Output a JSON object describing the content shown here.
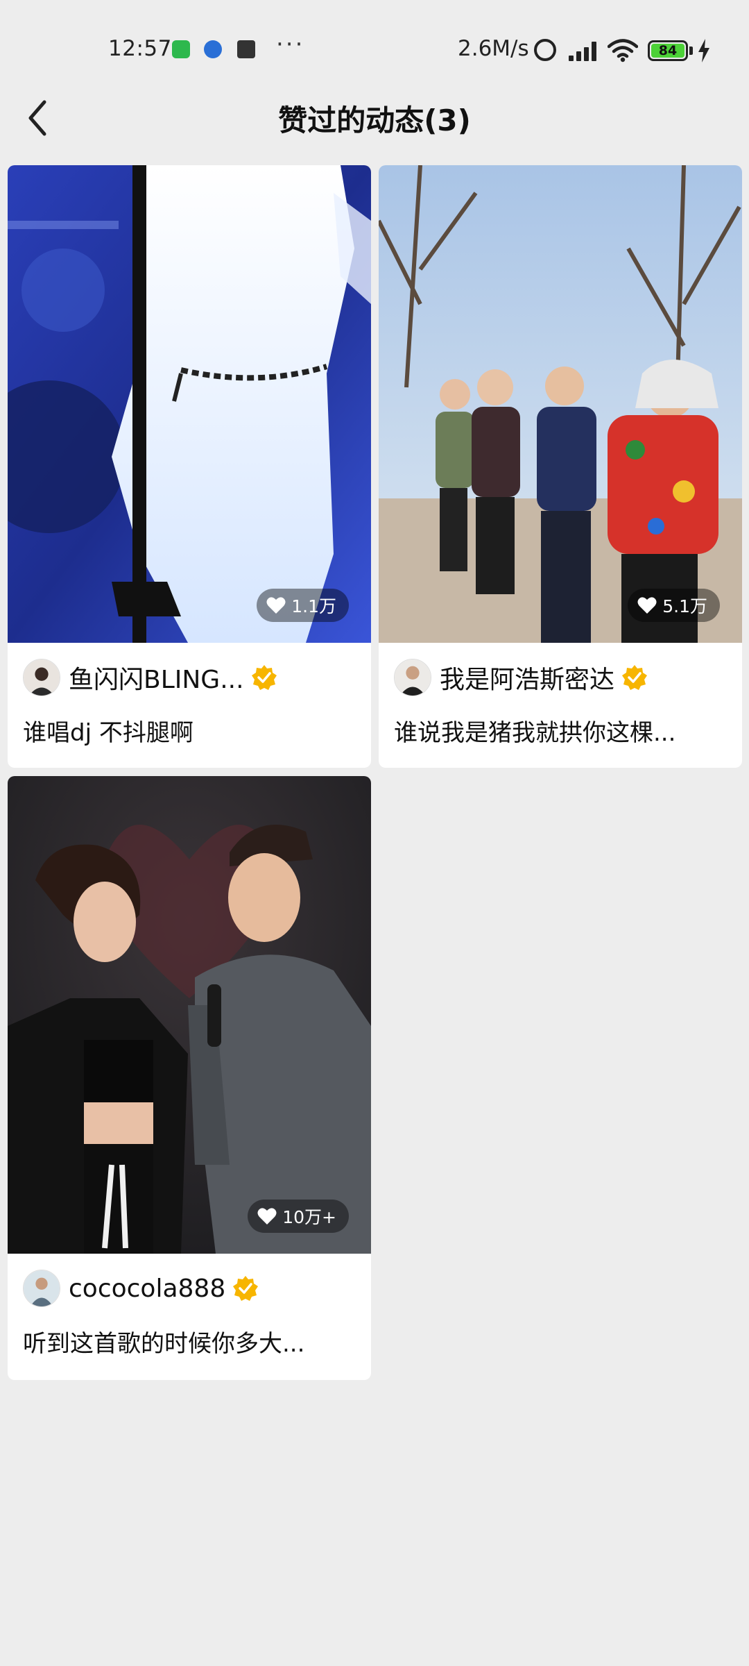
{
  "status_bar": {
    "time": "12:57",
    "more": "···",
    "network_speed": "2.6M/s",
    "battery": "84"
  },
  "header": {
    "title": "赞过的动态(3)"
  },
  "posts": [
    {
      "author": "鱼闪闪BLING...",
      "caption": "谁唱dj 不抖腿啊",
      "likes": "1.1万",
      "verified": true
    },
    {
      "author": "我是阿浩斯密达",
      "caption": "谁说我是猪我就拱你这棵...",
      "likes": "5.1万",
      "verified": true
    },
    {
      "author": "cococola888",
      "caption": "听到这首歌的时候你多大...",
      "likes": "10万+",
      "verified": true
    }
  ],
  "colors": {
    "background": "#ededed",
    "card": "#ffffff",
    "verified_badge": "#f7b500",
    "battery_fill": "#4cd137"
  }
}
